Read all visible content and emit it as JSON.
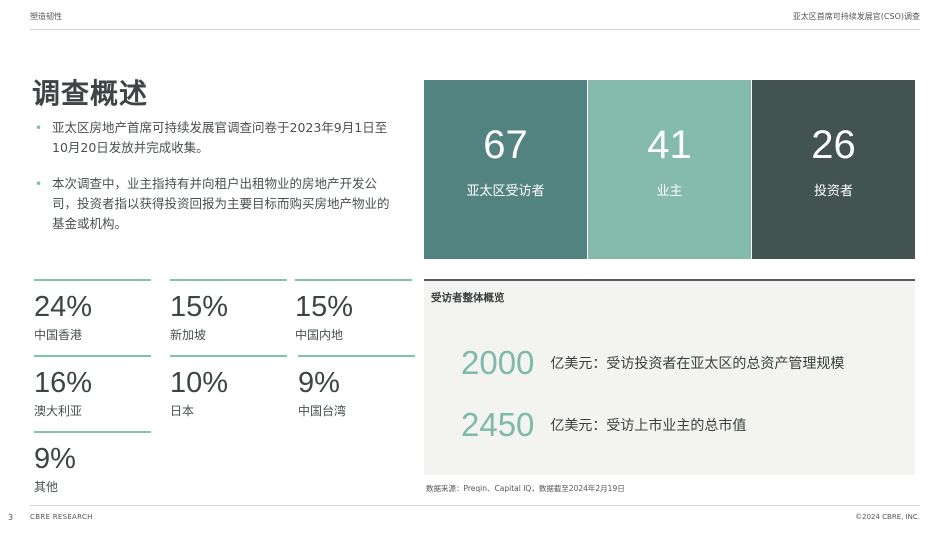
{
  "header": {
    "left": "塑造韧性",
    "right": "亚太区首席可持续发展官(CSO)调查"
  },
  "title": "调查概述",
  "bullets": [
    "亚太区房地产首席可持续发展官调查问卷于2023年9月1日至10月20日发放并完成收集。",
    "本次调查中，业主指持有并向租户出租物业的房地产开发公司，投资者指以获得投资回报为主要目标而购买房地产物业的基金或机构。"
  ],
  "regions": [
    {
      "pct": "24%",
      "label": "中国香港"
    },
    {
      "pct": "15%",
      "label": "新加坡"
    },
    {
      "pct": "15%",
      "label": "中国内地"
    },
    {
      "pct": "16%",
      "label": "澳大利亚"
    },
    {
      "pct": "10%",
      "label": "日本"
    },
    {
      "pct": "9%",
      "label": "中国台湾"
    },
    {
      "pct": "9%",
      "label": "其他"
    }
  ],
  "kpis": [
    {
      "value": "67",
      "label": "亚太区受访者",
      "color": "#538381"
    },
    {
      "value": "41",
      "label": "业主",
      "color": "#84bbab"
    },
    {
      "value": "26",
      "label": "投资者",
      "color": "#435351"
    }
  ],
  "overview": {
    "title": "受访者整体概览",
    "rows": [
      {
        "num": "2000",
        "text": "亿美元：受访投资者在亚太区的总资产管理规模"
      },
      {
        "num": "2450",
        "text": "亿美元：受访上市业主的总市值"
      }
    ]
  },
  "source": "数据来源：Preqin、Capital IQ，数据截至2024年2月19日",
  "footer": {
    "page": "3",
    "left": "CBRE RESEARCH",
    "right": "©2024 CBRE, INC."
  }
}
